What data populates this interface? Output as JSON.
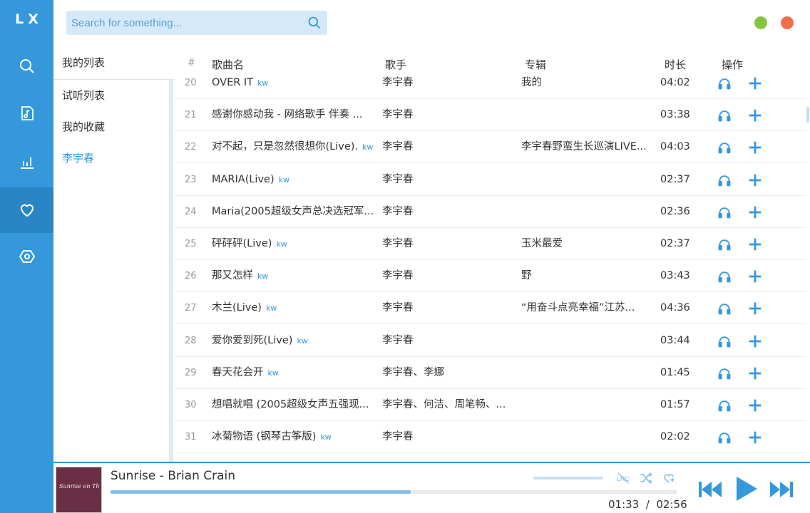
{
  "app": {
    "logo": "LX"
  },
  "nav": [
    "search-icon",
    "music-note-icon",
    "bar-chart-icon",
    "heart-icon",
    "settings-icon"
  ],
  "search": {
    "placeholder": "Search for something..."
  },
  "lists": {
    "title": "我的列表",
    "items": [
      {
        "label": "试听列表",
        "active": false
      },
      {
        "label": "我的收藏",
        "active": false
      },
      {
        "label": "李宇春",
        "active": true
      }
    ]
  },
  "table": {
    "headers": {
      "num": "#",
      "name": "歌曲名",
      "singer": "歌手",
      "album": "专辑",
      "duration": "时长",
      "actions": "操作"
    },
    "rows": [
      {
        "num": "20",
        "name": "OVER IT",
        "source": "kw",
        "singer": "李宇春",
        "album": "我的",
        "duration": "04:02"
      },
      {
        "num": "21",
        "name": "感谢你感动我 - 网络歌手 伴奏 ...",
        "source": "",
        "singer": "李宇春",
        "album": "",
        "duration": "03:38"
      },
      {
        "num": "22",
        "name": "对不起，只是忽然很想你(Live).",
        "source": "kw",
        "singer": "李宇春",
        "album": "李宇春野蛮生长巡演LIVE...",
        "duration": "04:03"
      },
      {
        "num": "23",
        "name": "MARIA(Live)",
        "source": "kw",
        "singer": "李宇春",
        "album": "",
        "duration": "02:37"
      },
      {
        "num": "24",
        "name": "Maria(2005超级女声总决选冠军...",
        "source": "",
        "singer": "李宇春",
        "album": "",
        "duration": "02:36"
      },
      {
        "num": "25",
        "name": "砰砰砰(Live)",
        "source": "kw",
        "singer": "李宇春",
        "album": "玉米最爱",
        "duration": "02:37"
      },
      {
        "num": "26",
        "name": "那又怎样",
        "source": "kw",
        "singer": "李宇春",
        "album": "野",
        "duration": "03:43"
      },
      {
        "num": "27",
        "name": "木兰(Live)",
        "source": "kw",
        "singer": "李宇春",
        "album": "“用奋斗点亮幸福”江苏...",
        "duration": "04:36"
      },
      {
        "num": "28",
        "name": "爱你爱到死(Live)",
        "source": "kw",
        "singer": "李宇春",
        "album": "",
        "duration": "03:44"
      },
      {
        "num": "29",
        "name": "春天花会开",
        "source": "kw",
        "singer": "李宇春、李娜",
        "album": "",
        "duration": "01:45"
      },
      {
        "num": "30",
        "name": "想唱就唱 (2005超级女声五强现...",
        "source": "",
        "singer": "李宇春、何洁、周笔畅、...",
        "album": "",
        "duration": "01:57"
      },
      {
        "num": "31",
        "name": "冰菊物语 (钢琴古筝版)",
        "source": "kw",
        "singer": "李宇春",
        "album": "",
        "duration": "02:02"
      }
    ]
  },
  "player": {
    "title": "Sunrise - Brian Crain",
    "cover_text": "Sunrise on Thrones",
    "current_time": "01:33",
    "separator": "/",
    "total_time": "02:56",
    "progress": 0.53,
    "volume": 1.0
  },
  "colors": {
    "accent": "#3498db",
    "nav_active": "#2a85c5",
    "green_dot": "#85c441",
    "red_dot": "#ef6f4a"
  }
}
